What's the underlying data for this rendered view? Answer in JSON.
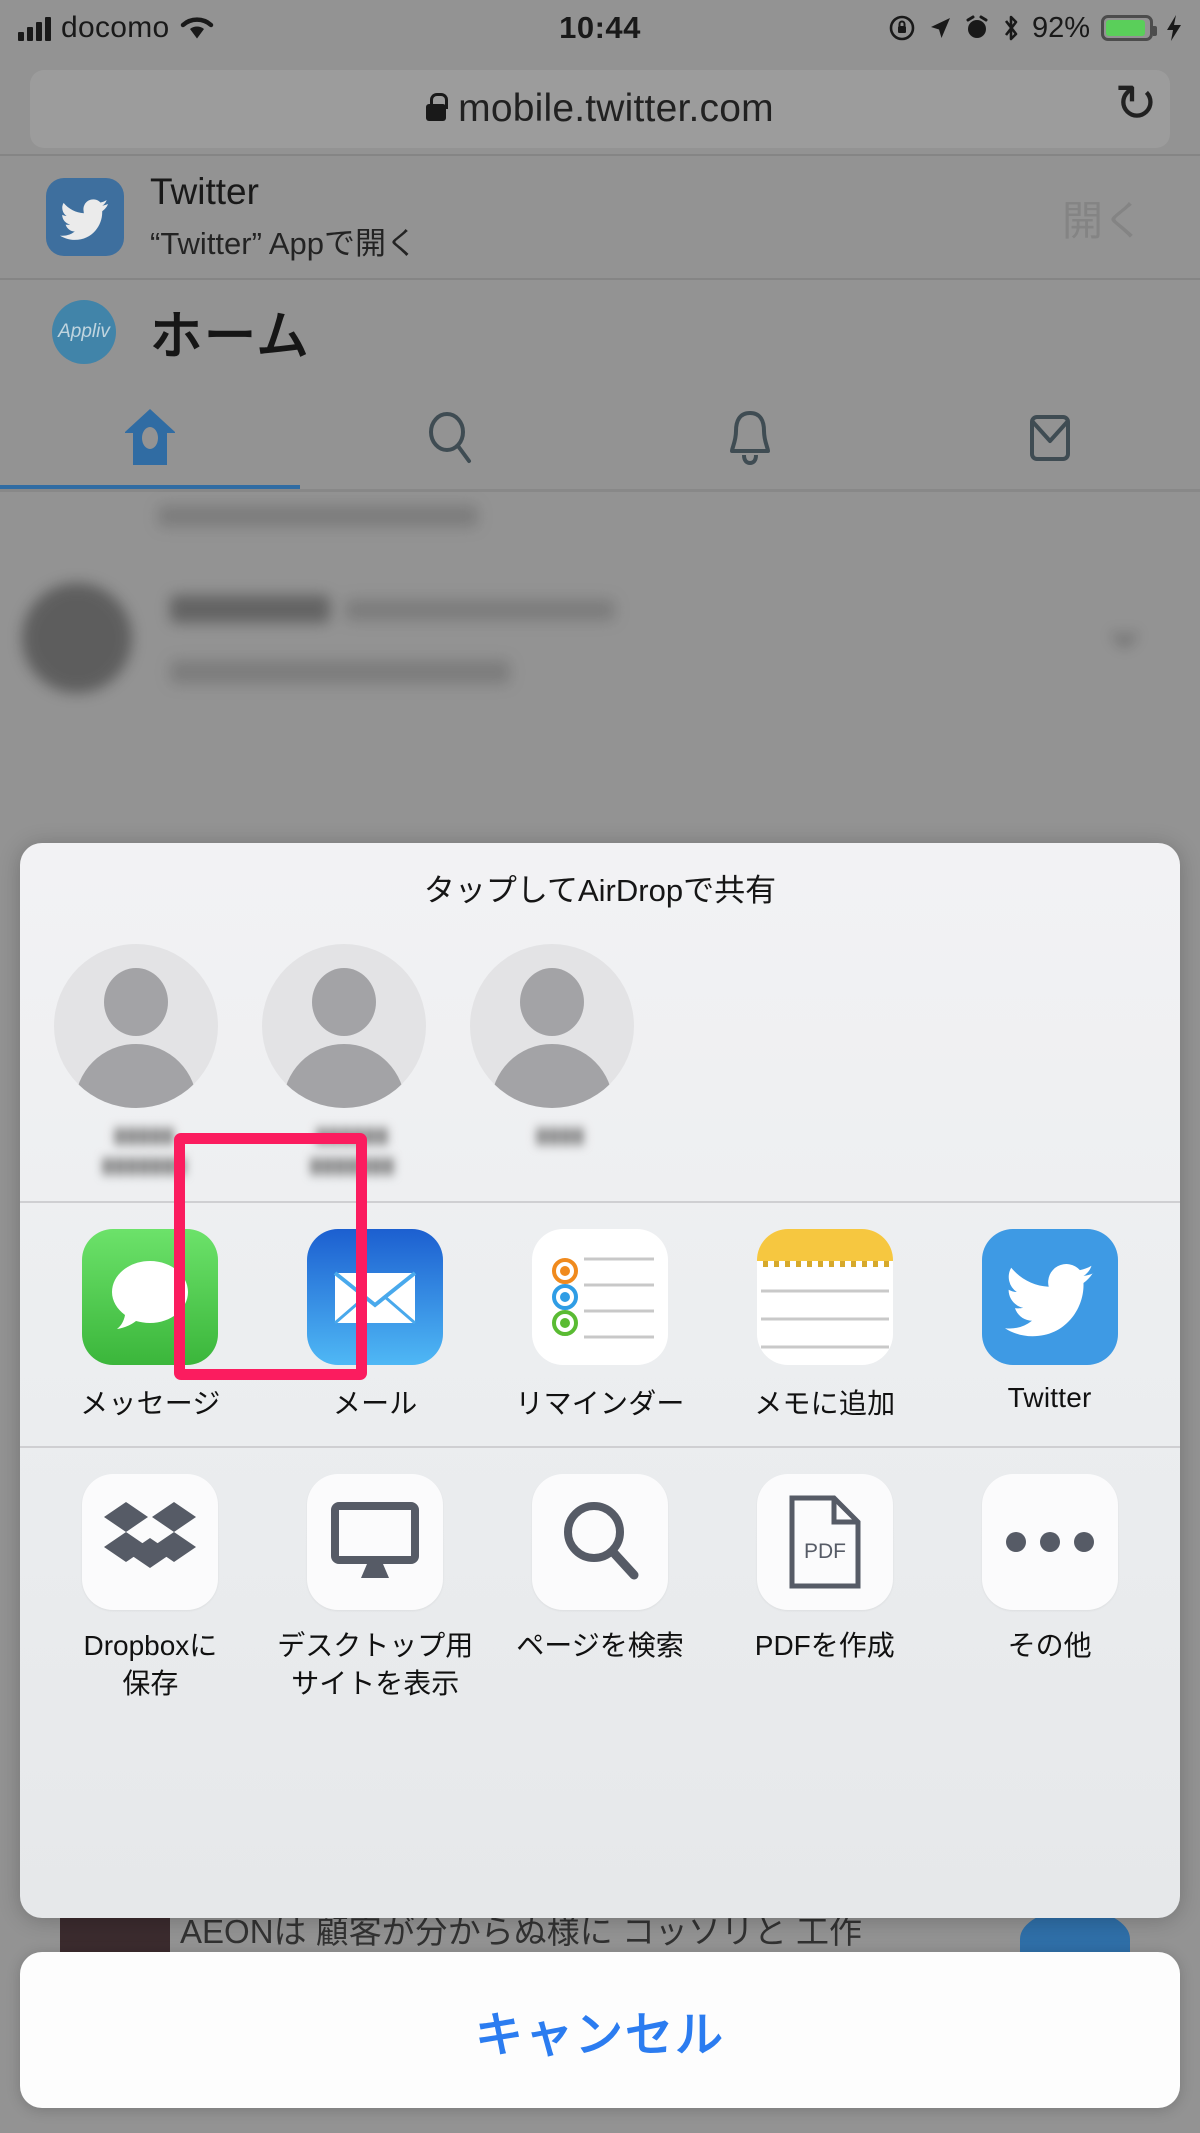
{
  "status_bar": {
    "carrier": "docomo",
    "time": "10:44",
    "battery_percent": "92%",
    "icons": [
      "signal-bars-icon",
      "wifi-icon",
      "rotation-lock-icon",
      "location-arrow-icon",
      "alarm-clock-icon",
      "bluetooth-icon",
      "battery-icon",
      "charging-bolt-icon"
    ]
  },
  "browser": {
    "url": "mobile.twitter.com",
    "lock_icon": "lock-icon",
    "reload_icon": "reload-icon"
  },
  "app_banner": {
    "app_name": "Twitter",
    "subtitle": "“Twitter” Appで開く",
    "open_label": "開く",
    "icon": "twitter-bird-icon"
  },
  "twitter_page": {
    "avatar_label": "Appliv",
    "title": "ホーム",
    "tabs": [
      {
        "name": "home",
        "icon": "home-icon",
        "active": true
      },
      {
        "name": "search",
        "icon": "search-icon",
        "active": false
      },
      {
        "name": "notifications",
        "icon": "bell-icon",
        "active": false
      },
      {
        "name": "messages",
        "icon": "envelope-icon",
        "active": false
      }
    ]
  },
  "share_sheet": {
    "airdrop_title": "タップしてAirDropで共有",
    "airdrop_contacts": [
      {
        "name": "blurred-contact-1"
      },
      {
        "name": "blurred-contact-2"
      },
      {
        "name": "blurred-contact-3"
      }
    ],
    "apps": [
      {
        "label": "メッセージ",
        "icon": "messages-icon"
      },
      {
        "label": "メール",
        "icon": "mail-icon"
      },
      {
        "label": "リマインダー",
        "icon": "reminders-icon"
      },
      {
        "label": "メモに追加",
        "icon": "notes-icon"
      },
      {
        "label": "Twitter",
        "icon": "twitter-icon"
      }
    ],
    "actions": [
      {
        "label": "Dropboxに\n保存",
        "label_line1": "Dropboxに",
        "label_line2": "保存",
        "icon": "dropbox-icon",
        "highlighted": false
      },
      {
        "label": "デスクトップ用\nサイトを表示",
        "label_line1": "デスクトップ用",
        "label_line2": "サイトを表示",
        "icon": "desktop-monitor-icon",
        "highlighted": true
      },
      {
        "label": "ページを検索",
        "label_line1": "ページを検索",
        "label_line2": "",
        "icon": "magnifier-icon",
        "highlighted": false
      },
      {
        "label": "PDFを作成",
        "label_line1": "PDFを作成",
        "label_line2": "",
        "icon": "pdf-document-icon",
        "highlighted": false
      },
      {
        "label": "その他",
        "label_line1": "その他",
        "label_line2": "",
        "icon": "ellipsis-icon",
        "highlighted": false
      }
    ],
    "cancel_label": "キャンセル",
    "highlight_color": "#fb1c5f"
  },
  "background_tweet": {
    "partial_text": "AEONは 顧客が分からぬ様に コッソリと 工作"
  },
  "colors": {
    "accent_blue": "#2b7cf0",
    "twitter_blue": "#3b9ae1",
    "highlight_pink": "#fb1c5f",
    "battery_green": "#5ae05a",
    "dim_gray": "#9b9b9b"
  }
}
